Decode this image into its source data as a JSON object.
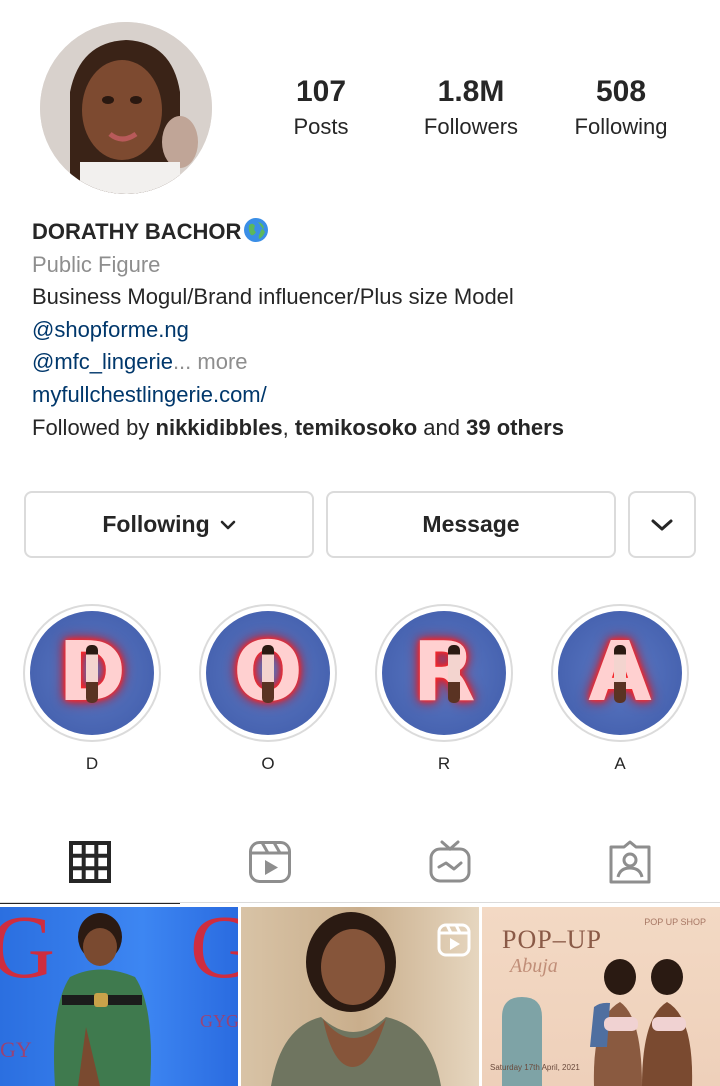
{
  "profile": {
    "stats": [
      {
        "value": "107",
        "label": "Posts"
      },
      {
        "value": "1.8M",
        "label": "Followers"
      },
      {
        "value": "508",
        "label": "Following"
      }
    ],
    "name": "DORATHY BACHOR",
    "category": "Public Figure",
    "bio_line": "Business Mogul/Brand influencer/Plus size Model",
    "mention_1": "@shopforme.ng",
    "mention_2": "@mfc_lingerie",
    "more_label": "... more",
    "website": "myfullchestlingerie.com/",
    "followed_by_prefix": "Followed by ",
    "followed_by_user1": "nikkidibbles",
    "followed_by_sep": ", ",
    "followed_by_user2": "temikosoko",
    "followed_by_and": " and ",
    "followed_by_others": "39 others"
  },
  "actions": {
    "following_label": "Following",
    "message_label": "Message"
  },
  "highlights": [
    {
      "letter": "D",
      "label": "D"
    },
    {
      "letter": "O",
      "label": "O"
    },
    {
      "letter": "R",
      "label": "R"
    },
    {
      "letter": "A",
      "label": "A"
    }
  ],
  "tabs": {
    "icons": [
      "grid-icon",
      "reels-icon",
      "igtv-icon",
      "tagged-icon"
    ],
    "active": "grid-icon"
  },
  "posts": {
    "post3_title": "POP–UP",
    "post3_subtitle": "Abuja",
    "post3_date": "Saturday 17th April, 2021",
    "post3_side": "POP UP SHOP"
  },
  "colors": {
    "link": "#00376b",
    "muted": "#8e8e8e",
    "border": "#dbdbdb",
    "text": "#262626"
  }
}
